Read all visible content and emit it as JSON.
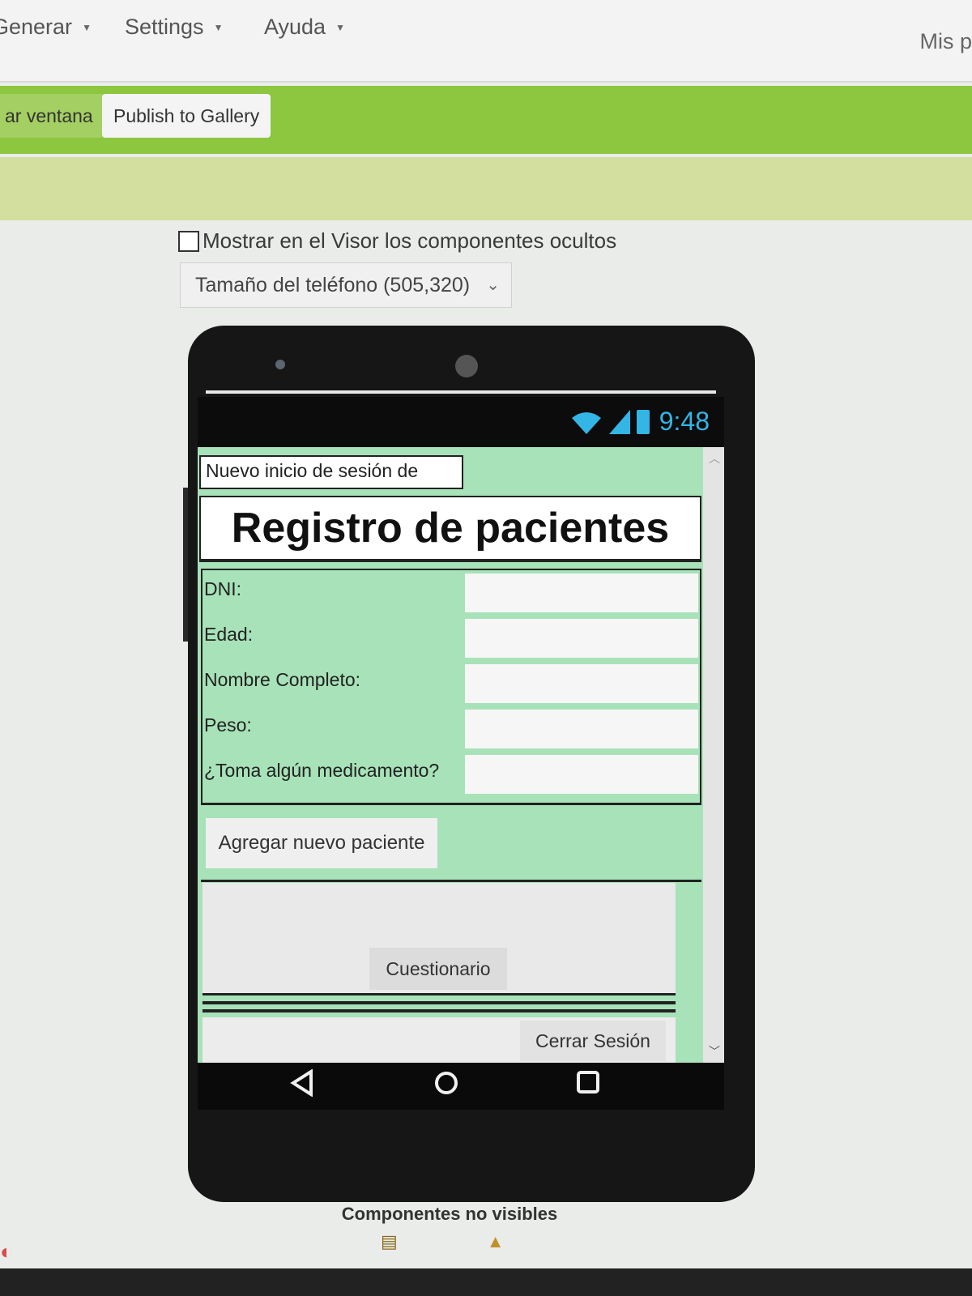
{
  "menu": {
    "items": [
      {
        "label": "Generar"
      },
      {
        "label": "Settings"
      },
      {
        "label": "Ayuda"
      }
    ],
    "right_label": "Mis p"
  },
  "toolbar": {
    "window_label": "ar ventana",
    "publish_label": "Publish to Gallery"
  },
  "designer": {
    "show_hidden_label": "Mostrar en el Visor los componentes ocultos",
    "phone_size_label": "Tamaño del teléfono (505,320)",
    "nonvisible_label": "Componentes no visibles"
  },
  "phone": {
    "clock": "9:48",
    "login_label": "Nuevo inicio de sesión de",
    "title": "Registro de pacientes",
    "fields": [
      {
        "label": "DNI:"
      },
      {
        "label": "Edad:"
      },
      {
        "label": "Nombre Completo:"
      },
      {
        "label": "Peso:"
      },
      {
        "label": "¿Toma algún medicamento?"
      }
    ],
    "add_button": "Agregar nuevo paciente",
    "quiz_button": "Cuestionario",
    "logout_button": "Cerrar Sesión"
  },
  "icons": {
    "wifi": "wifi-icon",
    "signal": "signal-icon",
    "battery": "battery-icon",
    "back": "back-icon",
    "home": "home-icon",
    "recents": "recents-icon",
    "database": "database-icon",
    "warning": "warning-icon"
  },
  "colors": {
    "toolbar_green": "#8dc63f",
    "app_background": "#a7e2b8",
    "status_blue": "#33b5e5"
  }
}
